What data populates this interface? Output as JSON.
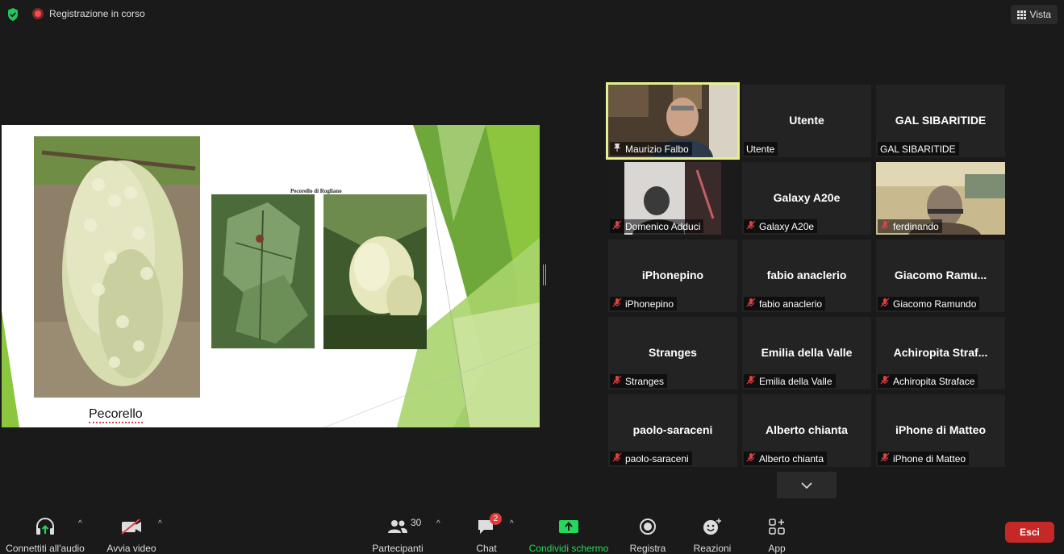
{
  "topbar": {
    "recording_label": "Registrazione in corso",
    "view_label": "Vista"
  },
  "slide": {
    "caption": "Pecorello di Rogliano",
    "title": "Pecorello"
  },
  "gallery": [
    {
      "big": "",
      "label": "Maurizio Falbo",
      "muted": false,
      "video": true,
      "active": true
    },
    {
      "big": "Utente",
      "label": "Utente",
      "muted": false,
      "video": false
    },
    {
      "big": "GAL SIBARITIDE",
      "label": "GAL SIBARITIDE",
      "muted": false,
      "video": false
    },
    {
      "big": "",
      "label": "Domenico Adduci",
      "muted": true,
      "video": true
    },
    {
      "big": "Galaxy A20e",
      "label": "Galaxy A20e",
      "muted": true,
      "video": false
    },
    {
      "big": "",
      "label": "ferdinando",
      "muted": true,
      "video": true
    },
    {
      "big": "iPhonepino",
      "label": "iPhonepino",
      "muted": true,
      "video": false
    },
    {
      "big": "fabio anaclerio",
      "label": "fabio anaclerio",
      "muted": true,
      "video": false
    },
    {
      "big": "Giacomo  Ramu...",
      "label": "Giacomo Ramundo",
      "muted": true,
      "video": false
    },
    {
      "big": "Stranges",
      "label": "Stranges",
      "muted": true,
      "video": false
    },
    {
      "big": "Emilia della Valle",
      "label": "Emilia della Valle",
      "muted": true,
      "video": false
    },
    {
      "big": "Achiropita  Straf...",
      "label": "Achiropita Straface",
      "muted": true,
      "video": false
    },
    {
      "big": "paolo-saraceni",
      "label": "paolo-saraceni",
      "muted": true,
      "video": false
    },
    {
      "big": "Alberto chianta",
      "label": "Alberto chianta",
      "muted": true,
      "video": false
    },
    {
      "big": "iPhone di Matteo",
      "label": "iPhone di Matteo",
      "muted": true,
      "video": false
    }
  ],
  "toolbar": {
    "audio": "Connettiti all'audio",
    "video": "Avvia video",
    "participants": "Partecipanti",
    "participants_count": "30",
    "chat": "Chat",
    "chat_badge": "2",
    "share": "Condividi schermo",
    "record": "Registra",
    "reactions": "Reazioni",
    "apps": "App",
    "exit": "Esci"
  },
  "colors": {
    "active_border": "#e4f08b",
    "exit_red": "#c62828",
    "share_green": "#23d959",
    "mute_red": "#e04040"
  }
}
